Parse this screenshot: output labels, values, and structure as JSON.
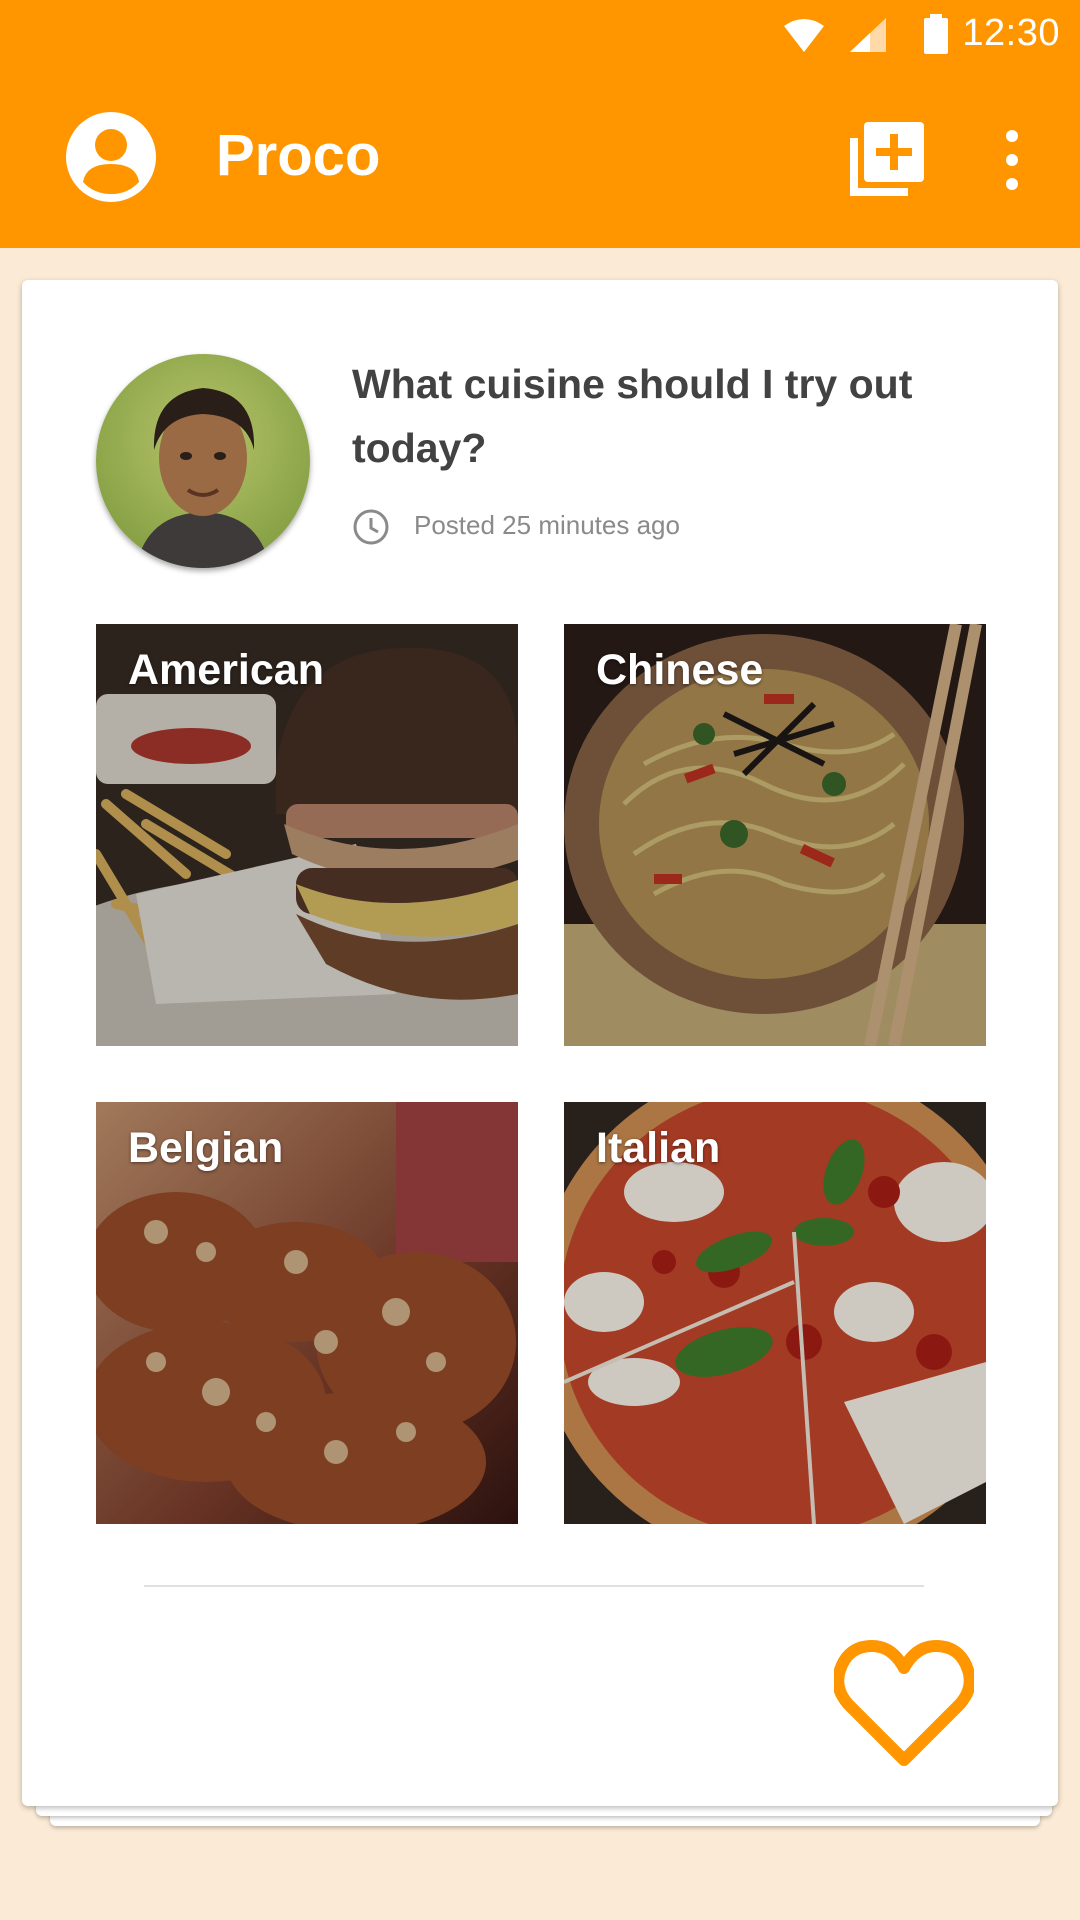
{
  "status_bar": {
    "time": "12:30",
    "icons": [
      "wifi-icon",
      "signal-icon",
      "battery-icon"
    ]
  },
  "app_bar": {
    "title": "Proco",
    "profile_icon": "account-circle-icon",
    "add_icon": "library-add-icon",
    "more_icon": "more-vert-icon",
    "color": "#FF9600"
  },
  "post": {
    "question": "What cuisine should I try out today?",
    "posted": "Posted 25 minutes ago",
    "options": [
      {
        "label": "American"
      },
      {
        "label": "Chinese"
      },
      {
        "label": "Belgian"
      },
      {
        "label": "Italian"
      }
    ],
    "like_icon": "heart-outline-icon"
  },
  "colors": {
    "accent": "#FF9600",
    "background": "#FBEBD6"
  }
}
